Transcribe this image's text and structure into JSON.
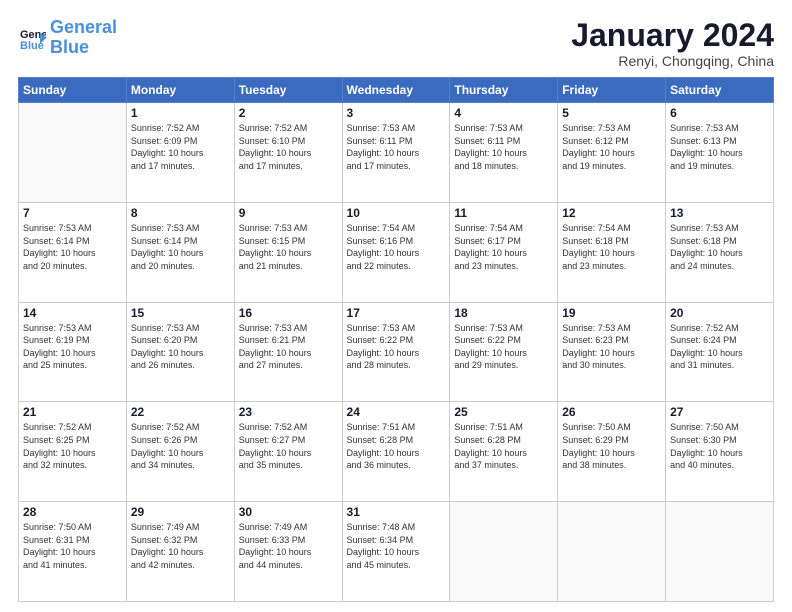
{
  "header": {
    "logo_line1": "General",
    "logo_line2": "Blue",
    "month_title": "January 2024",
    "location": "Renyi, Chongqing, China"
  },
  "days_of_week": [
    "Sunday",
    "Monday",
    "Tuesday",
    "Wednesday",
    "Thursday",
    "Friday",
    "Saturday"
  ],
  "weeks": [
    [
      {
        "day": "",
        "sunrise": "",
        "sunset": "",
        "daylight": ""
      },
      {
        "day": "1",
        "sunrise": "7:52 AM",
        "sunset": "6:09 PM",
        "daylight": "10 hours and 17 minutes."
      },
      {
        "day": "2",
        "sunrise": "7:52 AM",
        "sunset": "6:10 PM",
        "daylight": "10 hours and 17 minutes."
      },
      {
        "day": "3",
        "sunrise": "7:53 AM",
        "sunset": "6:11 PM",
        "daylight": "10 hours and 17 minutes."
      },
      {
        "day": "4",
        "sunrise": "7:53 AM",
        "sunset": "6:11 PM",
        "daylight": "10 hours and 18 minutes."
      },
      {
        "day": "5",
        "sunrise": "7:53 AM",
        "sunset": "6:12 PM",
        "daylight": "10 hours and 19 minutes."
      },
      {
        "day": "6",
        "sunrise": "7:53 AM",
        "sunset": "6:13 PM",
        "daylight": "10 hours and 19 minutes."
      }
    ],
    [
      {
        "day": "7",
        "sunrise": "7:53 AM",
        "sunset": "6:14 PM",
        "daylight": "10 hours and 20 minutes."
      },
      {
        "day": "8",
        "sunrise": "7:53 AM",
        "sunset": "6:14 PM",
        "daylight": "10 hours and 20 minutes."
      },
      {
        "day": "9",
        "sunrise": "7:53 AM",
        "sunset": "6:15 PM",
        "daylight": "10 hours and 21 minutes."
      },
      {
        "day": "10",
        "sunrise": "7:54 AM",
        "sunset": "6:16 PM",
        "daylight": "10 hours and 22 minutes."
      },
      {
        "day": "11",
        "sunrise": "7:54 AM",
        "sunset": "6:17 PM",
        "daylight": "10 hours and 23 minutes."
      },
      {
        "day": "12",
        "sunrise": "7:54 AM",
        "sunset": "6:18 PM",
        "daylight": "10 hours and 23 minutes."
      },
      {
        "day": "13",
        "sunrise": "7:53 AM",
        "sunset": "6:18 PM",
        "daylight": "10 hours and 24 minutes."
      }
    ],
    [
      {
        "day": "14",
        "sunrise": "7:53 AM",
        "sunset": "6:19 PM",
        "daylight": "10 hours and 25 minutes."
      },
      {
        "day": "15",
        "sunrise": "7:53 AM",
        "sunset": "6:20 PM",
        "daylight": "10 hours and 26 minutes."
      },
      {
        "day": "16",
        "sunrise": "7:53 AM",
        "sunset": "6:21 PM",
        "daylight": "10 hours and 27 minutes."
      },
      {
        "day": "17",
        "sunrise": "7:53 AM",
        "sunset": "6:22 PM",
        "daylight": "10 hours and 28 minutes."
      },
      {
        "day": "18",
        "sunrise": "7:53 AM",
        "sunset": "6:22 PM",
        "daylight": "10 hours and 29 minutes."
      },
      {
        "day": "19",
        "sunrise": "7:53 AM",
        "sunset": "6:23 PM",
        "daylight": "10 hours and 30 minutes."
      },
      {
        "day": "20",
        "sunrise": "7:52 AM",
        "sunset": "6:24 PM",
        "daylight": "10 hours and 31 minutes."
      }
    ],
    [
      {
        "day": "21",
        "sunrise": "7:52 AM",
        "sunset": "6:25 PM",
        "daylight": "10 hours and 32 minutes."
      },
      {
        "day": "22",
        "sunrise": "7:52 AM",
        "sunset": "6:26 PM",
        "daylight": "10 hours and 34 minutes."
      },
      {
        "day": "23",
        "sunrise": "7:52 AM",
        "sunset": "6:27 PM",
        "daylight": "10 hours and 35 minutes."
      },
      {
        "day": "24",
        "sunrise": "7:51 AM",
        "sunset": "6:28 PM",
        "daylight": "10 hours and 36 minutes."
      },
      {
        "day": "25",
        "sunrise": "7:51 AM",
        "sunset": "6:28 PM",
        "daylight": "10 hours and 37 minutes."
      },
      {
        "day": "26",
        "sunrise": "7:50 AM",
        "sunset": "6:29 PM",
        "daylight": "10 hours and 38 minutes."
      },
      {
        "day": "27",
        "sunrise": "7:50 AM",
        "sunset": "6:30 PM",
        "daylight": "10 hours and 40 minutes."
      }
    ],
    [
      {
        "day": "28",
        "sunrise": "7:50 AM",
        "sunset": "6:31 PM",
        "daylight": "10 hours and 41 minutes."
      },
      {
        "day": "29",
        "sunrise": "7:49 AM",
        "sunset": "6:32 PM",
        "daylight": "10 hours and 42 minutes."
      },
      {
        "day": "30",
        "sunrise": "7:49 AM",
        "sunset": "6:33 PM",
        "daylight": "10 hours and 44 minutes."
      },
      {
        "day": "31",
        "sunrise": "7:48 AM",
        "sunset": "6:34 PM",
        "daylight": "10 hours and 45 minutes."
      },
      {
        "day": "",
        "sunrise": "",
        "sunset": "",
        "daylight": ""
      },
      {
        "day": "",
        "sunrise": "",
        "sunset": "",
        "daylight": ""
      },
      {
        "day": "",
        "sunrise": "",
        "sunset": "",
        "daylight": ""
      }
    ]
  ]
}
